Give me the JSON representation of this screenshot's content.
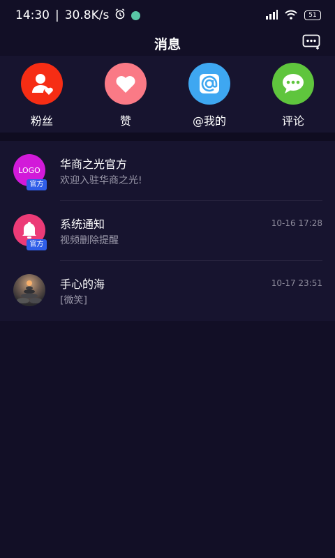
{
  "status_bar": {
    "time": "14:30",
    "separator": "|",
    "speed": "30.8K/s",
    "battery": "51"
  },
  "header": {
    "title": "消息"
  },
  "quick_actions": [
    {
      "label": "粉丝",
      "color": "#f62d14",
      "icon": "person-heart-icon"
    },
    {
      "label": "赞",
      "color": "#fa7a86",
      "icon": "heart-icon"
    },
    {
      "label": "@我的",
      "color": "#3ea7f1",
      "icon": "at-icon"
    },
    {
      "label": "评论",
      "color": "#5fc53d",
      "icon": "chat-bubble-icon"
    }
  ],
  "messages": [
    {
      "name": "华商之光官方",
      "preview": "欢迎入驻华商之光!",
      "time": "",
      "badge": "官方",
      "avatar_text": "LOGO",
      "avatar_color": "#d21ad9"
    },
    {
      "name": "系统通知",
      "preview": "视频删除提醒",
      "time": "10-16 17:28",
      "badge": "官方",
      "avatar_color": "#ec3b77"
    },
    {
      "name": "手心的海",
      "preview": "[微笑]",
      "time": "10-17 23:51"
    }
  ]
}
